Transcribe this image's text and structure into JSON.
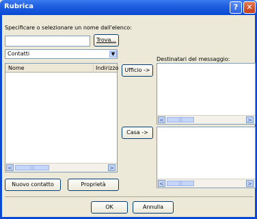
{
  "window": {
    "title": "Rubrica",
    "help_glyph": "?",
    "close_glyph": "✕"
  },
  "instruction": "Specificare o selezionare un nome dall'elenco:",
  "search": {
    "value": "",
    "button_label": "Trova..."
  },
  "source_select": {
    "value": "Contatti"
  },
  "contacts_table": {
    "columns": [
      "Nome",
      "Indirizzo"
    ],
    "rows": []
  },
  "recipients_label": "Destinatari del messaggio:",
  "office_button": "Ufficio ->",
  "home_button": "Casa ->",
  "new_contact_button": "Nuovo contatto",
  "properties_button": "Proprietà",
  "ok_button": "OK",
  "cancel_button": "Annulla",
  "scroll": {
    "left": "<",
    "right": ">",
    "thumb": "|||"
  },
  "colors": {
    "titlebar": "#0a49d4",
    "face": "#ece9d8",
    "field_border": "#7f9db9"
  }
}
